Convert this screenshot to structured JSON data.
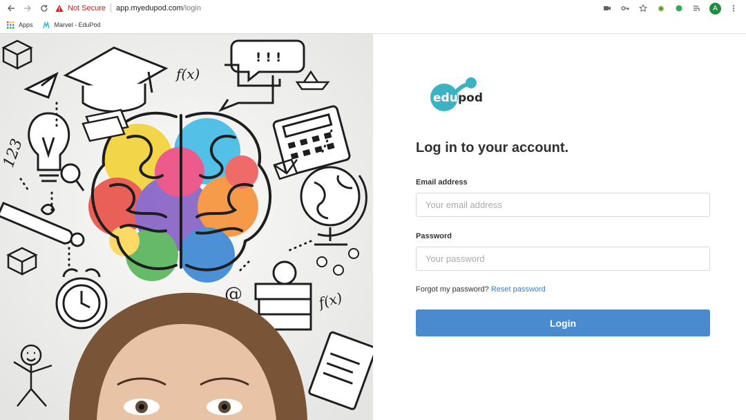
{
  "browser": {
    "security_label": "Not Secure",
    "url_host": "app.myedupod.com",
    "url_path": "/login",
    "profile_initial": "A",
    "bookmarks": [
      {
        "label": "Apps",
        "icon": "apps-grid-icon"
      },
      {
        "label": "Marvel - EduPod",
        "icon": "marvel-icon"
      }
    ],
    "accent_profile": "#1e8e3e"
  },
  "hero": {
    "image": "student-brain-doodle-illustration",
    "doodle_text": {
      "exclaim": "! ! !",
      "formula_top": "f(x)",
      "formula_bottom": "f(x)",
      "numbers": "123",
      "at_sign": "@"
    }
  },
  "login": {
    "logo_text_edu": "edu",
    "logo_text_pod": "pod",
    "logo_color": "#3bb3c3",
    "heading": "Log in to your account.",
    "email_label": "Email address",
    "email_placeholder": "Your email address",
    "password_label": "Password",
    "password_placeholder": "Your password",
    "forgot_text": "Forgot my password?",
    "reset_link": "Reset password",
    "submit_label": "Login",
    "button_color": "#4a8bd0"
  }
}
